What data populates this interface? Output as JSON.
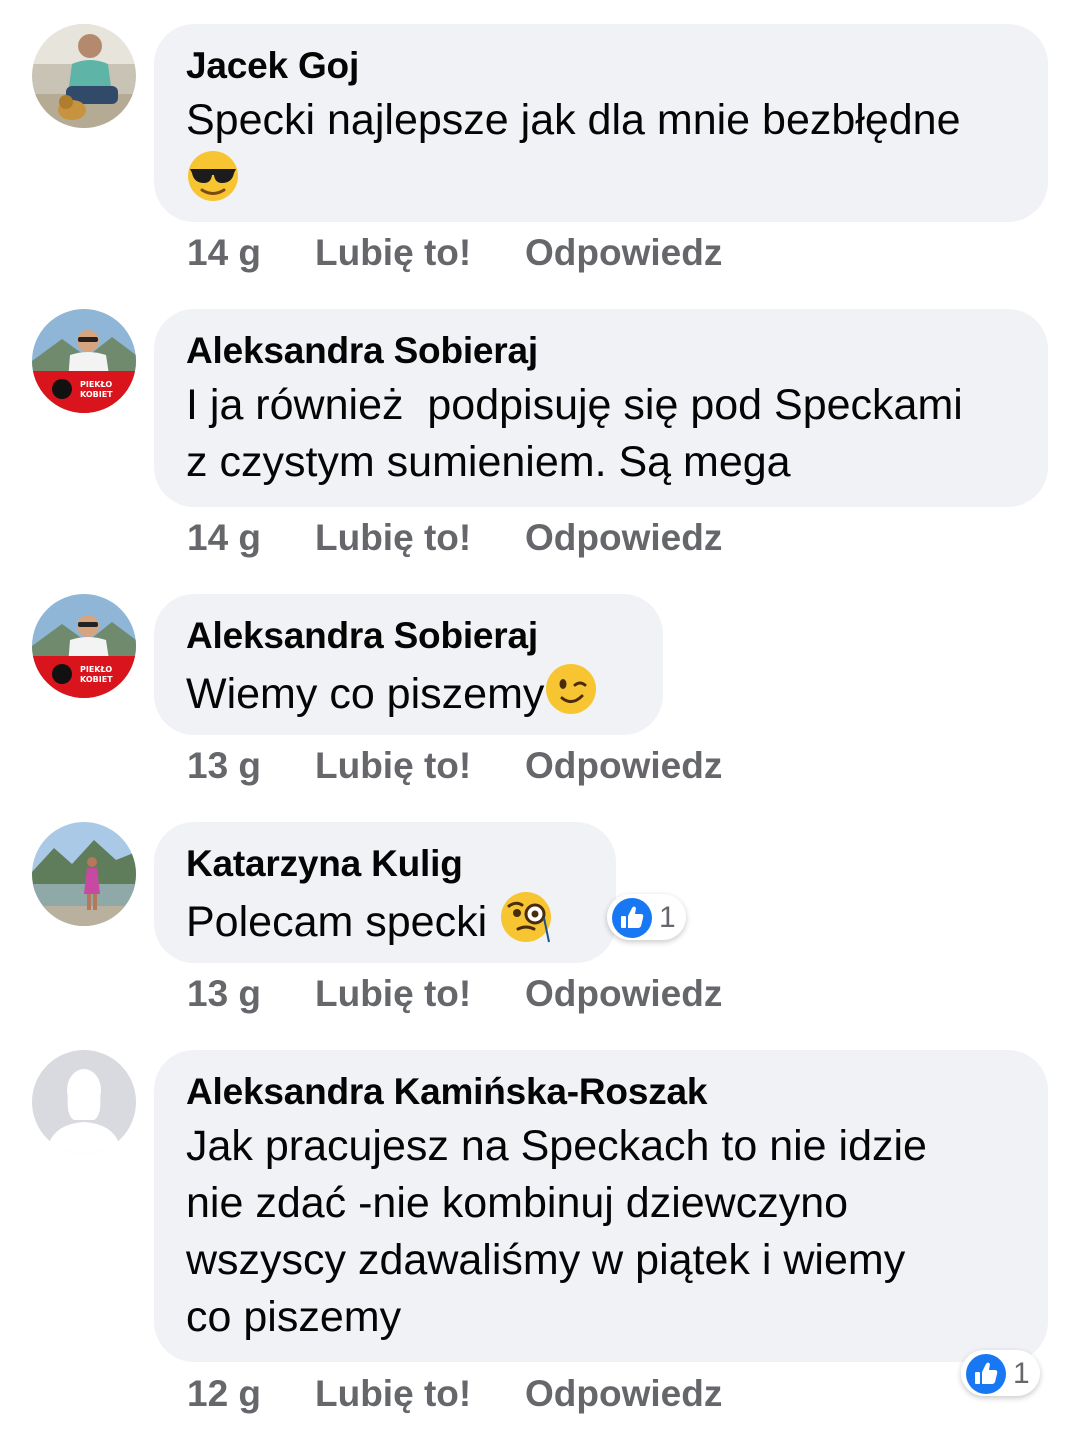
{
  "comments": [
    {
      "author": "Jacek Goj",
      "text_lines": [
        "Specki najlepsze jak dla mnie bezbłędne"
      ],
      "emoji": "sunglasses-emoji",
      "time": "14 g",
      "like_label": "Lubię to!",
      "reply_label": "Odpowiedz"
    },
    {
      "author": "Aleksandra Sobieraj",
      "text_lines": [
        "I ja również  podpisuję się pod Speckami",
        "z czystym sumieniem. Są mega"
      ],
      "avatar_badge": [
        "PIEKŁO",
        "KOBIET"
      ],
      "time": "14 g",
      "like_label": "Lubię to!",
      "reply_label": "Odpowiedz"
    },
    {
      "author": "Aleksandra Sobieraj",
      "text_lines": [
        "Wiemy co piszemy"
      ],
      "emoji": "winking-face-emoji",
      "avatar_badge": [
        "PIEKŁO",
        "KOBIET"
      ],
      "time": "13 g",
      "like_label": "Lubię to!",
      "reply_label": "Odpowiedz"
    },
    {
      "author": "Katarzyna Kulig",
      "text_lines": [
        "Polecam specki "
      ],
      "emoji": "face-with-monocle-emoji",
      "reaction_count": "1",
      "time": "13 g",
      "like_label": "Lubię to!",
      "reply_label": "Odpowiedz"
    },
    {
      "author": "Aleksandra Kamińska-Roszak",
      "text_lines": [
        "Jak pracujesz na Speckach to nie idzie",
        "nie zdać -nie kombinuj dziewczyno",
        "wszyscy zdawaliśmy w piątek i wiemy",
        "co piszemy"
      ],
      "reaction_count": "1",
      "time": "12 g",
      "like_label": "Lubię to!",
      "reply_label": "Odpowiedz"
    }
  ],
  "colors": {
    "bubble": "#f0f2f5",
    "secondary_text": "#65676b",
    "like_blue": "#1877f2"
  }
}
